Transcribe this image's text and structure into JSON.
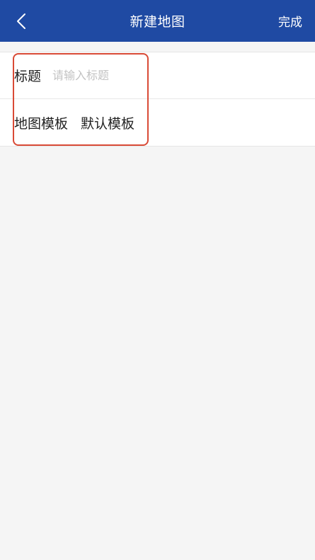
{
  "header": {
    "back_icon": "chevron-left-icon",
    "title": "新建地图",
    "done_label": "完成",
    "background_color": "#1f4aa3"
  },
  "form": {
    "title_row": {
      "label": "标题",
      "value": "",
      "placeholder": "请输入标题"
    },
    "template_row": {
      "label": "地图模板",
      "value": "默认模板"
    }
  },
  "annotation": {
    "color": "#d94a36"
  }
}
